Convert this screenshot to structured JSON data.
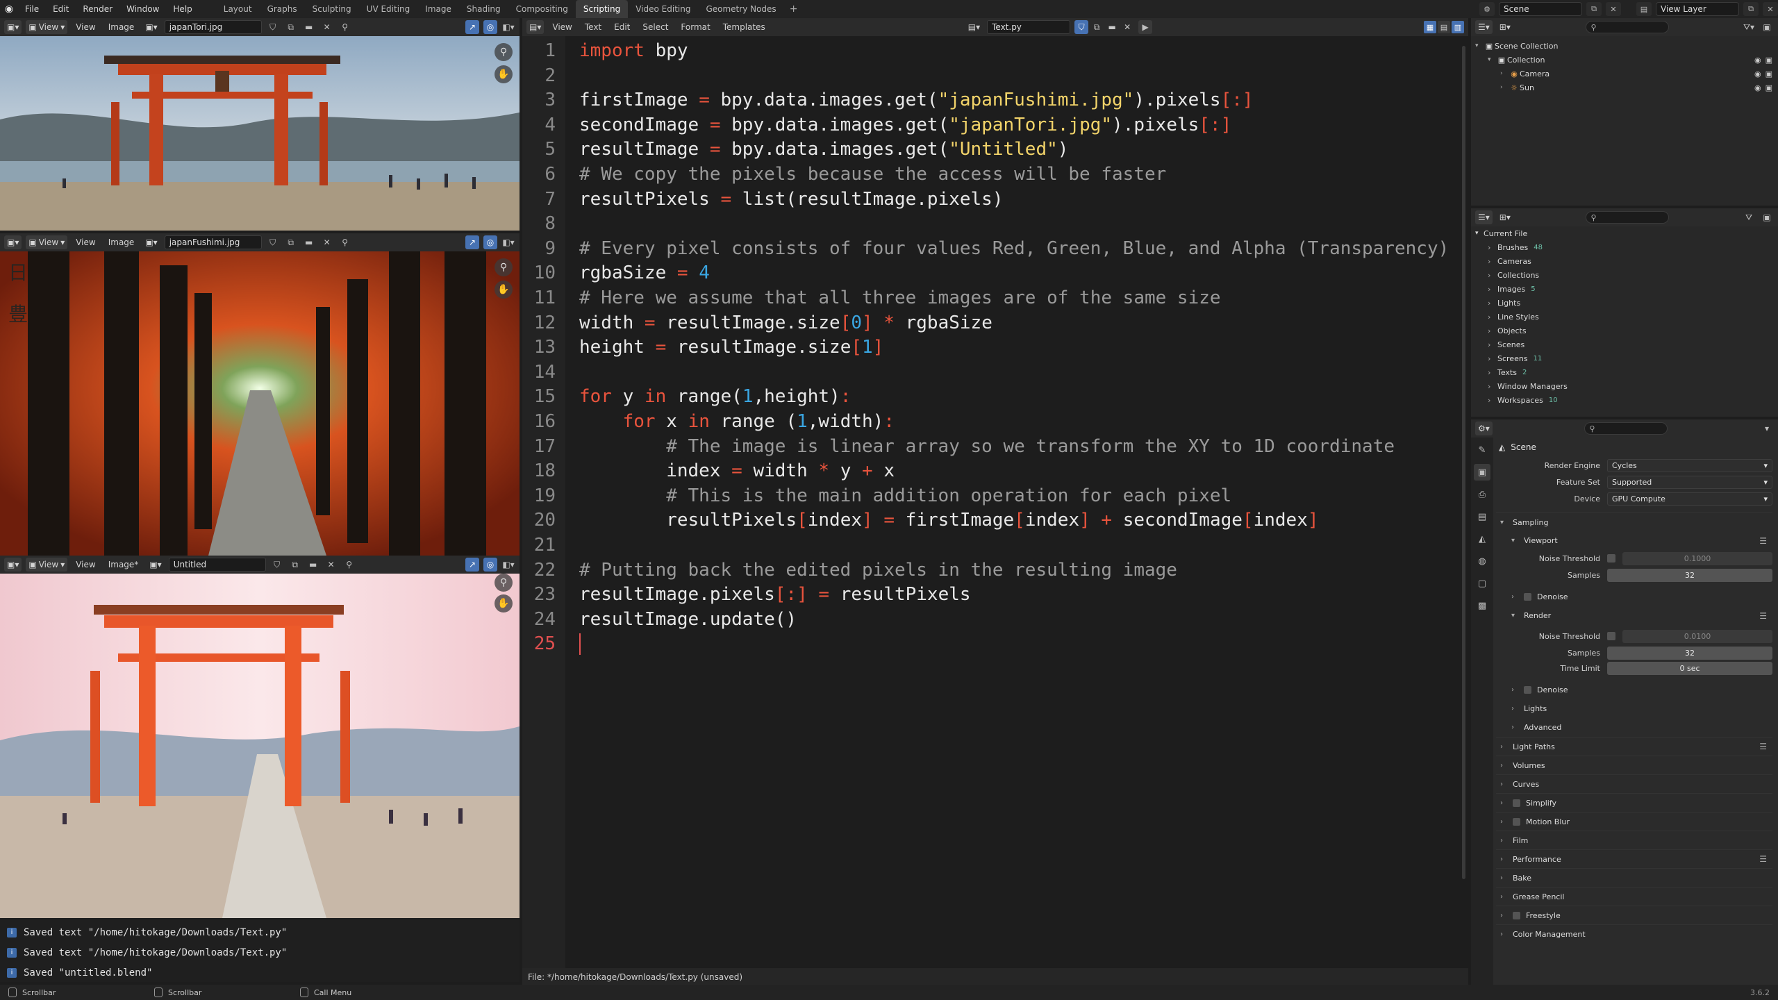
{
  "topbar": {
    "menus": [
      "File",
      "Edit",
      "Render",
      "Window",
      "Help"
    ],
    "workspaces": [
      "Layout",
      "Graphs",
      "Sculpting",
      "UV Editing",
      "Image",
      "Shading",
      "Compositing",
      "Scripting",
      "Video Editing",
      "Geometry Nodes"
    ],
    "active_workspace": "Scripting",
    "add_tab": "+",
    "scene": "Scene",
    "view_layer": "View Layer"
  },
  "image_editors": [
    {
      "view": "View",
      "menus": [
        "View",
        "Image"
      ],
      "image": "japanTori.jpg"
    },
    {
      "view": "View",
      "menus": [
        "View",
        "Image"
      ],
      "image": "japanFushimi.jpg"
    },
    {
      "view": "View",
      "menus": [
        "View",
        "Image*"
      ],
      "image": "Untitled"
    }
  ],
  "info_log": [
    "Saved text \"/home/hitokage/Downloads/Text.py\"",
    "Saved text \"/home/hitokage/Downloads/Text.py\"",
    "Saved \"untitled.blend\""
  ],
  "text_editor": {
    "menus": [
      "View",
      "Text",
      "Edit",
      "Select",
      "Format",
      "Templates"
    ],
    "file_name": "Text.py",
    "footer": "File: */home/hitokage/Downloads/Text.py (unsaved)",
    "current_line": 25,
    "lines": [
      [
        [
          "kw",
          "import"
        ],
        [
          "id",
          " bpy"
        ]
      ],
      [],
      [
        [
          "id",
          "firstImage "
        ],
        [
          "op",
          "="
        ],
        [
          "id",
          " bpy.data.images.get("
        ],
        [
          "str",
          "\"japanFushimi.jpg\""
        ],
        [
          "id",
          ").pixels"
        ],
        [
          "op",
          "[:]"
        ]
      ],
      [
        [
          "id",
          "secondImage "
        ],
        [
          "op",
          "="
        ],
        [
          "id",
          " bpy.data.images.get("
        ],
        [
          "str",
          "\"japanTori.jpg\""
        ],
        [
          "id",
          ").pixels"
        ],
        [
          "op",
          "[:]"
        ]
      ],
      [
        [
          "id",
          "resultImage "
        ],
        [
          "op",
          "="
        ],
        [
          "id",
          " bpy.data.images.get("
        ],
        [
          "str",
          "\"Untitled\""
        ],
        [
          "id",
          ")"
        ]
      ],
      [
        [
          "cmt",
          "# We copy the pixels because the access will be faster"
        ]
      ],
      [
        [
          "id",
          "resultPixels "
        ],
        [
          "op",
          "="
        ],
        [
          "id",
          " list(resultImage.pixels)"
        ]
      ],
      [],
      [
        [
          "cmt",
          "# Every pixel consists of four values Red, Green, Blue, and Alpha (Transparency)"
        ]
      ],
      [
        [
          "id",
          "rgbaSize "
        ],
        [
          "op",
          "="
        ],
        [
          "num",
          " 4"
        ]
      ],
      [
        [
          "cmt",
          "# Here we assume that all three images are of the same size"
        ]
      ],
      [
        [
          "id",
          "width "
        ],
        [
          "op",
          "="
        ],
        [
          "id",
          " resultImage.size"
        ],
        [
          "op",
          "["
        ],
        [
          "num",
          "0"
        ],
        [
          "op",
          "]"
        ],
        [
          "op",
          " *"
        ],
        [
          "id",
          " rgbaSize"
        ]
      ],
      [
        [
          "id",
          "height "
        ],
        [
          "op",
          "="
        ],
        [
          "id",
          " resultImage.size"
        ],
        [
          "op",
          "["
        ],
        [
          "num",
          "1"
        ],
        [
          "op",
          "]"
        ]
      ],
      [],
      [
        [
          "kw",
          "for"
        ],
        [
          "id",
          " y "
        ],
        [
          "kw",
          "in"
        ],
        [
          "id",
          " range("
        ],
        [
          "num",
          "1"
        ],
        [
          "id",
          ",height)"
        ],
        [
          "op",
          ":"
        ]
      ],
      [
        [
          "id",
          "    "
        ],
        [
          "kw",
          "for"
        ],
        [
          "id",
          " x "
        ],
        [
          "kw",
          "in"
        ],
        [
          "id",
          " range ("
        ],
        [
          "num",
          "1"
        ],
        [
          "id",
          ",width)"
        ],
        [
          "op",
          ":"
        ]
      ],
      [
        [
          "cmt",
          "        # The image is linear array so we transform the XY to 1D coordinate"
        ]
      ],
      [
        [
          "id",
          "        index "
        ],
        [
          "op",
          "="
        ],
        [
          "id",
          " width "
        ],
        [
          "op",
          "*"
        ],
        [
          "id",
          " y "
        ],
        [
          "op",
          "+"
        ],
        [
          "id",
          " x"
        ]
      ],
      [
        [
          "cmt",
          "        # This is the main addition operation for each pixel"
        ]
      ],
      [
        [
          "id",
          "        resultPixels"
        ],
        [
          "op",
          "["
        ],
        [
          "id",
          "index"
        ],
        [
          "op",
          "]"
        ],
        [
          "op",
          " ="
        ],
        [
          "id",
          " firstImage"
        ],
        [
          "op",
          "["
        ],
        [
          "id",
          "index"
        ],
        [
          "op",
          "]"
        ],
        [
          "op",
          " +"
        ],
        [
          "id",
          " secondImage"
        ],
        [
          "op",
          "["
        ],
        [
          "id",
          "index"
        ],
        [
          "op",
          "]"
        ]
      ],
      [],
      [
        [
          "cmt",
          "# Putting back the edited pixels in the resulting image"
        ]
      ],
      [
        [
          "id",
          "resultImage.pixels"
        ],
        [
          "op",
          "[:]"
        ],
        [
          "op",
          " ="
        ],
        [
          "id",
          " resultPixels"
        ]
      ],
      [
        [
          "id",
          "resultImage.update()"
        ]
      ],
      []
    ]
  },
  "outliner": {
    "rows": [
      {
        "label": "Scene Collection",
        "indent": 0,
        "icon": "▣"
      },
      {
        "label": "Collection",
        "indent": 1,
        "icon": "▣"
      },
      {
        "label": "Camera",
        "indent": 2,
        "icon": "◉"
      },
      {
        "label": "Sun",
        "indent": 2,
        "icon": "☼"
      }
    ]
  },
  "data_api": {
    "root": "Current File",
    "items": [
      {
        "label": "Brushes",
        "badge": "48"
      },
      {
        "label": "Cameras",
        "badge": ""
      },
      {
        "label": "Collections",
        "badge": ""
      },
      {
        "label": "Images",
        "badge": "5"
      },
      {
        "label": "Lights",
        "badge": ""
      },
      {
        "label": "Line Styles",
        "badge": ""
      },
      {
        "label": "Objects",
        "badge": ""
      },
      {
        "label": "Scenes",
        "badge": ""
      },
      {
        "label": "Screens",
        "badge": "11"
      },
      {
        "label": "Texts",
        "badge": "2"
      },
      {
        "label": "Window Managers",
        "badge": ""
      },
      {
        "label": "Workspaces",
        "badge": "10"
      }
    ]
  },
  "properties": {
    "title": "Scene",
    "render_engine_label": "Render Engine",
    "render_engine": "Cycles",
    "feature_set_label": "Feature Set",
    "feature_set": "Supported",
    "device_label": "Device",
    "device": "GPU Compute",
    "sampling": "Sampling",
    "viewport": "Viewport",
    "noise_threshold_label": "Noise Threshold",
    "viewport_noise": "0.1000",
    "samples_label": "Samples",
    "viewport_samples": "32",
    "denoise": "Denoise",
    "render": "Render",
    "render_noise": "0.0100",
    "render_samples": "32",
    "time_limit_label": "Time Limit",
    "time_limit": "0 sec",
    "sub_panels": [
      "Denoise",
      "Lights",
      "Advanced"
    ],
    "panels": [
      "Light Paths",
      "Volumes",
      "Curves",
      "Simplify",
      "Motion Blur",
      "Film",
      "Performance",
      "Bake",
      "Grease Pencil",
      "Freestyle",
      "Color Management"
    ]
  },
  "statusbar": {
    "items": [
      "Scrollbar",
      "Scrollbar",
      "Call Menu"
    ],
    "version": "3.6.2"
  }
}
